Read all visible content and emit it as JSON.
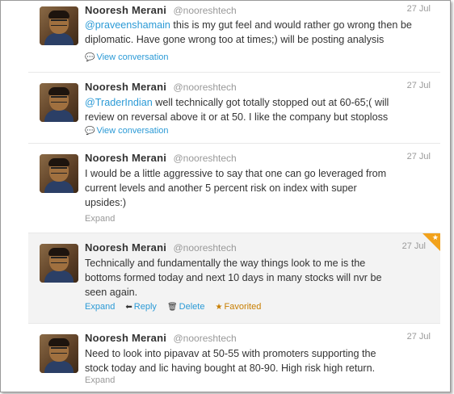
{
  "tweets": [
    {
      "name": "Nooresh Merani",
      "handle": "@nooreshtech",
      "date": "27 Jul",
      "lines": [
        {
          "mention": "@praveenshamain",
          "text": " this is my gut feel and would rather go wrong then be"
        },
        {
          "mention": "",
          "text": "diplomatic. Have gone wrong too at times;) will be posting analysis"
        }
      ],
      "actions": {
        "view": "View conversation"
      }
    },
    {
      "name": "Nooresh Merani",
      "handle": "@nooreshtech",
      "date": "27 Jul",
      "lines": [
        {
          "mention": "@TraderIndian",
          "text": " well technically got totally stopped out at 60-65;( will"
        },
        {
          "mention": "",
          "text": "review on reversal above it or at 50. I like the company but stoploss"
        }
      ],
      "actions": {
        "view": "View conversation"
      }
    },
    {
      "name": "Nooresh Merani",
      "handle": "@nooreshtech",
      "date": "27 Jul",
      "lines": [
        {
          "mention": "",
          "text": "I would be a little aggressive to say that one can go leveraged from"
        },
        {
          "mention": "",
          "text": "current levels and another 5 percent risk on index with super"
        },
        {
          "mention": "",
          "text": "upsides:)"
        }
      ],
      "actions": {
        "expand": "Expand"
      }
    },
    {
      "name": "Nooresh Merani",
      "handle": "@nooreshtech",
      "date": "27 Jul",
      "lines": [
        {
          "mention": "",
          "text": "Technically and fundamentally the way things look to me is the"
        },
        {
          "mention": "",
          "text": "bottoms formed today and next 10 days in many stocks will nvr be"
        },
        {
          "mention": "",
          "text": "seen again."
        }
      ],
      "actions": {
        "expand": "Expand",
        "reply": "Reply",
        "delete": "Delete",
        "favorited": "Favorited"
      }
    },
    {
      "name": "Nooresh Merani",
      "handle": "@nooreshtech",
      "date": "27 Jul",
      "lines": [
        {
          "mention": "",
          "text": "Need to look into pipavav at 50-55 with promoters supporting the"
        },
        {
          "mention": "",
          "text": "stock today and lic having bought at 80-90. High risk high return."
        }
      ],
      "actions": {
        "expand": "Expand"
      }
    }
  ],
  "colors": {
    "link": "#2b9ad6",
    "favorite": "#f2a21c",
    "text": "#333333",
    "muted": "#999999"
  },
  "icons": {
    "conversation": "speech-bubble-icon",
    "reply": "reply-arrow-icon",
    "delete": "trash-icon",
    "favorite": "star-icon"
  }
}
